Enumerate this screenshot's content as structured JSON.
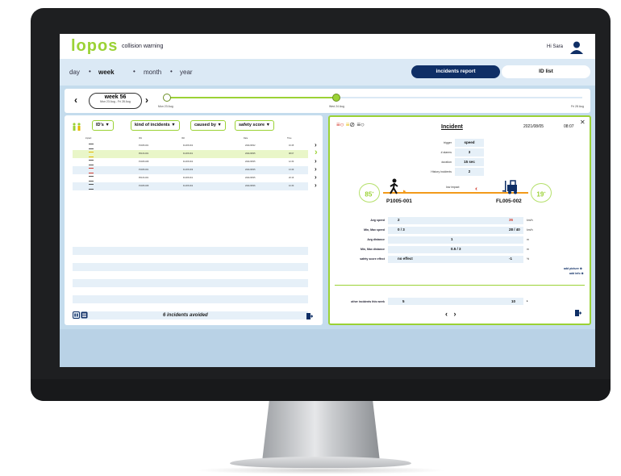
{
  "app": {
    "logo": "lopos",
    "title": "collision warning",
    "greeting": "Hi Sara"
  },
  "periods": [
    "day",
    "week",
    "month",
    "year"
  ],
  "active_period": "week",
  "buttons": {
    "incidents_report": "incidents report",
    "id_list": "ID list"
  },
  "timeline": {
    "week_label": "week 56",
    "week_range": "Mon 23 Aug - Fri 28 Aug",
    "start": "Mon 23 Aug",
    "mid": "Wed 24 Aug",
    "end": "Fri 28 Aug"
  },
  "filters": {
    "ids": "ID's ▼",
    "kind": "kind of incidents ▼",
    "caused_by": "caused by ▼",
    "safety": "safety score ▼"
  },
  "table": {
    "columns": [
      "impact",
      "ID1",
      "ID2",
      "Date",
      "Time"
    ],
    "rows": [
      {
        "id1": "P1005-001",
        "id2": "FL005-002",
        "date": "2021/08/02",
        "time": "16:45",
        "color": "#555555",
        "selected": false
      },
      {
        "id1": "P0103-001",
        "id2": "FL005-001",
        "date": "2021/08/05",
        "time": "08:07",
        "color": "#e6b800",
        "selected": true
      },
      {
        "id1": "P1005-008",
        "id2": "FL005-002",
        "date": "2021/08/05",
        "time": "12:30",
        "color": "#555555",
        "selected": false
      },
      {
        "id1": "P1005-001",
        "id2": "FL005-009",
        "date": "2021/08/05",
        "time": "13:49",
        "color": "#d33a2c",
        "selected": false
      },
      {
        "id1": "P0103-001",
        "id2": "FL005-001",
        "date": "2021/08/05",
        "time": "20:16",
        "color": "#555555",
        "selected": false
      },
      {
        "id1": "P1005-008",
        "id2": "FL005-002",
        "date": "2021/08/06",
        "time": "10:30",
        "color": "#555555",
        "selected": false
      }
    ]
  },
  "footer": {
    "avoided": "6 incidents avoided"
  },
  "incident": {
    "title": "Incident",
    "date": "2021/08/05",
    "time": "08:07",
    "details": [
      {
        "label": "trigger",
        "value": "speed"
      },
      {
        "label": "# alarms",
        "value": "3"
      },
      {
        "label": "duration",
        "value": "15 sec"
      },
      {
        "label": "History incidents",
        "value": "2"
      }
    ],
    "score_left": "85",
    "score_right": "19",
    "entity_left": "P1005-001",
    "entity_right": "FL005-002",
    "impact": "low impact",
    "metrics": [
      {
        "label": "Avg speed",
        "left": "2",
        "right": "36",
        "unit": "km/h"
      },
      {
        "label": "Min, Max speed",
        "left": "0 / 3",
        "right": "28 / 40",
        "unit": "km/h"
      },
      {
        "label": "Avg distance",
        "center": "1",
        "unit": "m"
      },
      {
        "label": "Min, Max distance",
        "center": "0.5 / 3",
        "unit": "m"
      },
      {
        "label": "safety score effect",
        "left": "no effect",
        "right": "-1",
        "unit": "%"
      }
    ],
    "add_picture": "add picture",
    "add_info": "add info",
    "other_label": "other incidents this week",
    "other_left": "5",
    "other_right": "10"
  },
  "colors": {
    "brand_green": "#9bd235",
    "navy": "#0f2f66",
    "orange": "#f29a1a",
    "red": "#d33a2c"
  }
}
